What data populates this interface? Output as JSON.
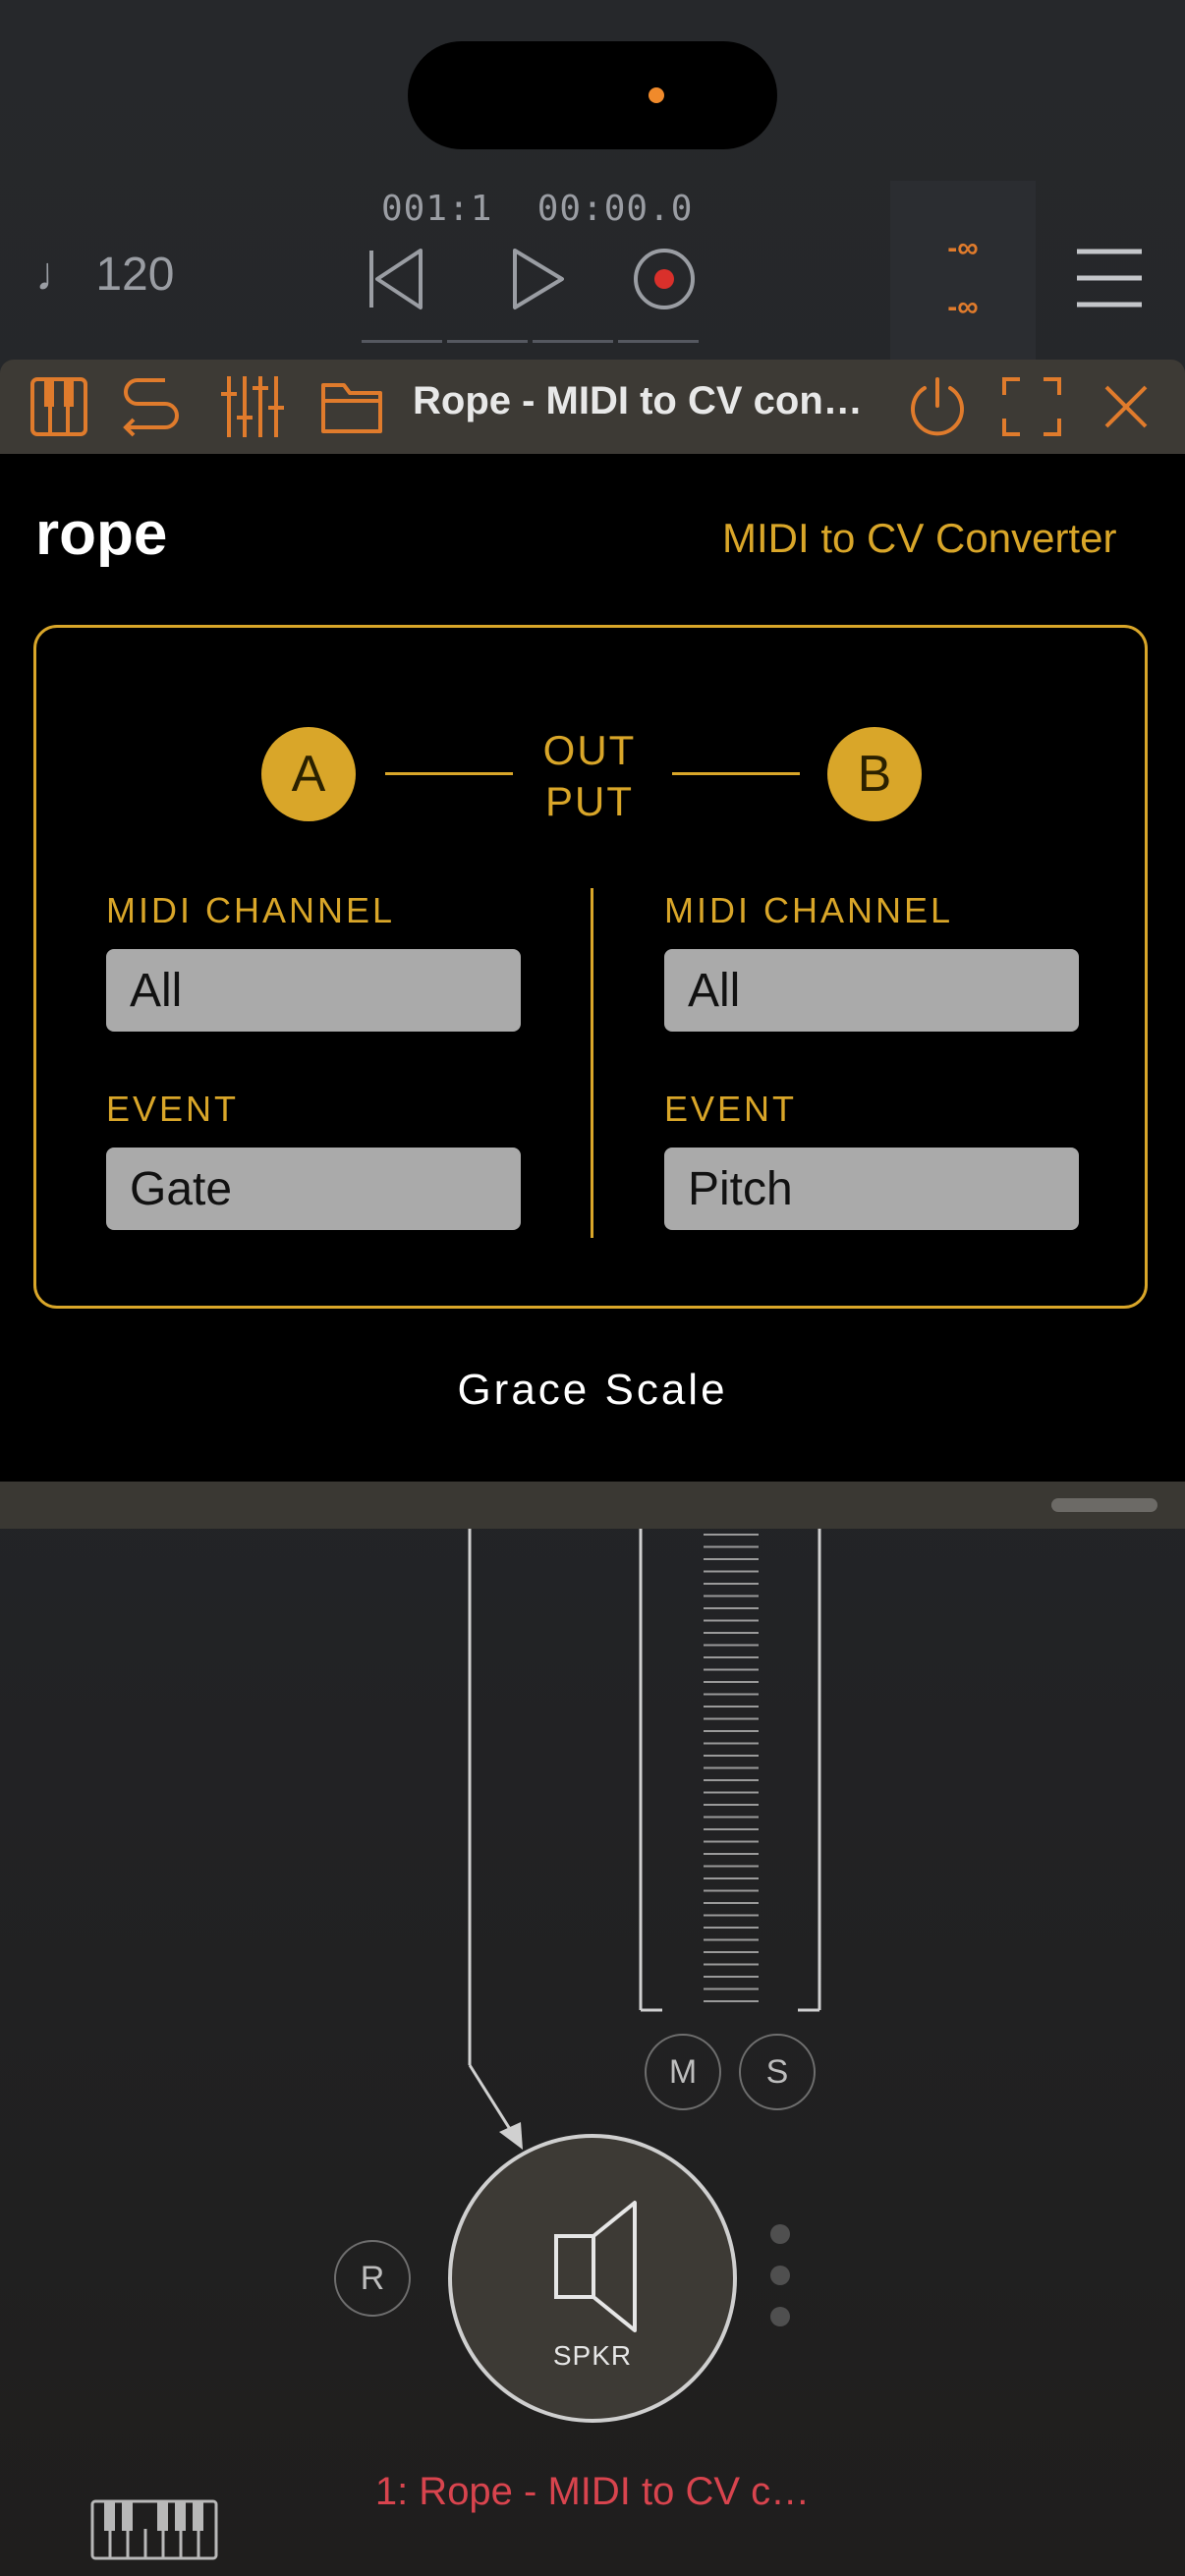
{
  "transport": {
    "tempo": "♩ 120",
    "position": "001:1",
    "time": "00:00.0",
    "meter_top": "-∞",
    "meter_bottom": "-∞"
  },
  "plugin_header": {
    "title": "Rope - MIDI to CV con…"
  },
  "plugin": {
    "brand": "rope",
    "subtitle": "MIDI to CV Converter",
    "port_a": "A",
    "port_b": "B",
    "output_label_line1": "OUT",
    "output_label_line2": "PUT",
    "left": {
      "channel_label": "MIDI CHANNEL",
      "channel_value": "All",
      "event_label": "EVENT",
      "event_value": "Gate"
    },
    "right": {
      "channel_label": "MIDI CHANNEL",
      "channel_value": "All",
      "event_label": "EVENT",
      "event_value": "Pitch"
    },
    "footer": "Grace Scale"
  },
  "graph": {
    "mute_label": "M",
    "solo_label": "S",
    "record_label": "R",
    "speaker_label": "SPKR",
    "track_name": "1: Rope - MIDI to CV c…"
  },
  "colors": {
    "accent_orange": "#e07b2c",
    "plugin_gold": "#d9a629",
    "track_red": "#d8444e",
    "record_red": "#d9302b"
  }
}
